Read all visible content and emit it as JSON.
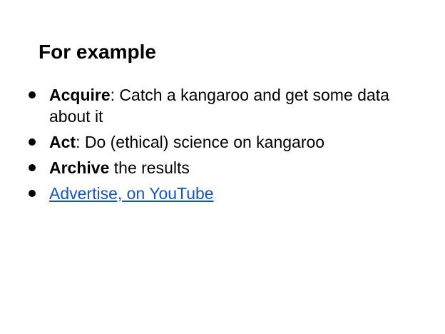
{
  "slide": {
    "title": "For example",
    "bullets": [
      {
        "bold": "Acquire",
        "text": ": Catch a kangaroo and get some data about it"
      },
      {
        "bold": "Act",
        "text": ": Do (ethical) science on kangaroo"
      },
      {
        "bold": "Archive",
        "text": " the results"
      },
      {
        "link": "Advertise, on YouTube"
      }
    ]
  },
  "colors": {
    "text": "#000000",
    "link": "#1155cc",
    "background": "#ffffff"
  }
}
